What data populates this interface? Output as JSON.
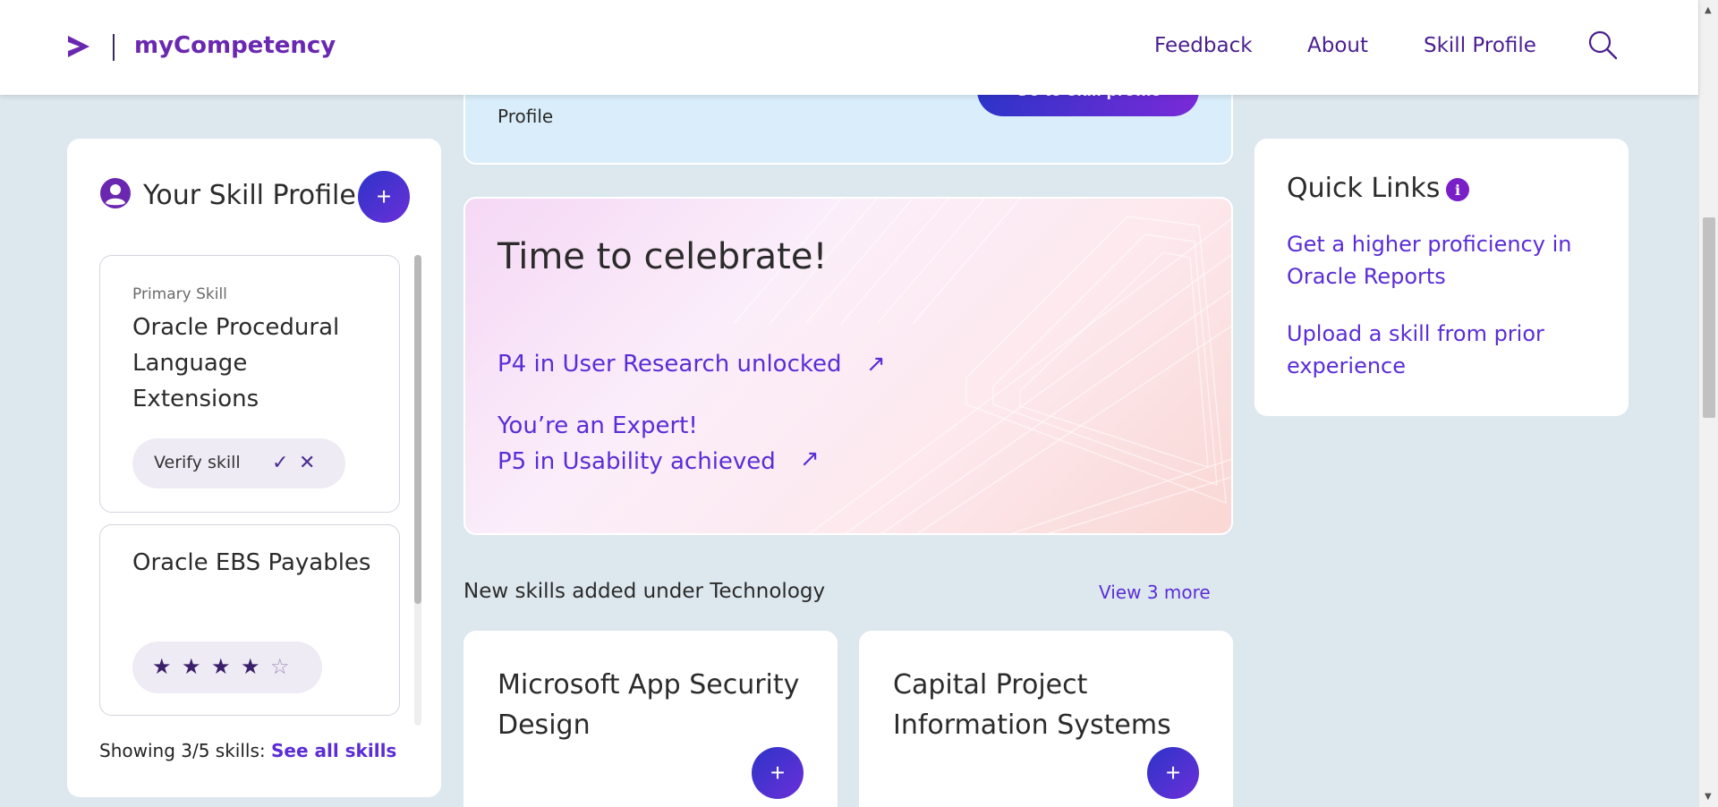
{
  "header": {
    "brand": "myCompetency",
    "nav": {
      "feedback": "Feedback",
      "about": "About",
      "skill_profile": "Skill Profile"
    },
    "icons": {
      "logo": "accenture-chevron-logo",
      "search": "search-icon"
    }
  },
  "banner": {
    "text": "Profile",
    "button_label": "Go to skill profile"
  },
  "skill_panel": {
    "title": "Your Skill Profile",
    "add_label": "+",
    "skills": [
      {
        "kind": "Primary Skill",
        "name": "Oracle Procedural Language Extensions",
        "verify_label": "Verify skill",
        "check": "✓",
        "cross": "✕"
      },
      {
        "kind": "",
        "name": "Oracle EBS Payables",
        "rating": 4,
        "max_rating": 5
      }
    ],
    "showing_text": "Showing 3/5 skills: ",
    "see_all": "See all skills"
  },
  "celebrate": {
    "title": "Time to celebrate!",
    "links": [
      {
        "text": "P4 in User Research unlocked"
      },
      {
        "line1": "You’re an Expert!",
        "line2": "P5 in Usability achieved"
      }
    ],
    "arrow": "↗"
  },
  "new_skills": {
    "section_title": "New skills added under Technology",
    "view_more": "View 3 more",
    "cards": [
      {
        "title": "Microsoft App Security Design",
        "add_label": "+"
      },
      {
        "title": "Capital Project Information Systems",
        "add_label": "+"
      }
    ]
  },
  "quick_links": {
    "title": "Quick Links",
    "info": "i",
    "links": [
      "Get a higher proficiency in Oracle Reports",
      "Upload a skill from prior experience"
    ]
  },
  "colors": {
    "accent": "#5a2dd6",
    "brand": "#6a28b0",
    "background": "#dde8ee",
    "gradient_start": "#2d34c8",
    "gradient_end": "#6b2fd8"
  }
}
